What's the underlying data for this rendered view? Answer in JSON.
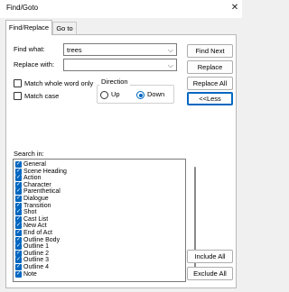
{
  "window": {
    "title": "Find/Goto",
    "close_glyph": "✕"
  },
  "tabs": [
    {
      "label": "Find/Replace",
      "active": true
    },
    {
      "label": "Go to",
      "active": false
    }
  ],
  "find": {
    "label": "Find what:",
    "value": "trees"
  },
  "replace": {
    "label": "Replace with:",
    "value": ""
  },
  "options": {
    "match_whole_word": {
      "label": "Match whole word only",
      "checked": false
    },
    "match_case": {
      "label": "Match case",
      "checked": false
    }
  },
  "direction": {
    "label": "Direction",
    "options": [
      {
        "label": "Up",
        "selected": false
      },
      {
        "label": "Down",
        "selected": true
      }
    ]
  },
  "buttons": {
    "find_next": "Find Next",
    "replace": "Replace",
    "replace_all": "Replace All",
    "less": "<<Less",
    "include_all": "Include All",
    "exclude_all": "Exclude All"
  },
  "search_in": {
    "label": "Search in:",
    "items": [
      {
        "label": "General",
        "checked": true
      },
      {
        "label": "Scene Heading",
        "checked": true
      },
      {
        "label": "Action",
        "checked": true
      },
      {
        "label": "Character",
        "checked": true
      },
      {
        "label": "Parenthetical",
        "checked": true
      },
      {
        "label": "Dialogue",
        "checked": true
      },
      {
        "label": "Transition",
        "checked": true
      },
      {
        "label": "Shot",
        "checked": true
      },
      {
        "label": "Cast List",
        "checked": true
      },
      {
        "label": "New Act",
        "checked": true
      },
      {
        "label": "End of Act",
        "checked": true
      },
      {
        "label": "Outline Body",
        "checked": true
      },
      {
        "label": "Outline 1",
        "checked": true
      },
      {
        "label": "Outline 2",
        "checked": true
      },
      {
        "label": "Outline 3",
        "checked": true
      },
      {
        "label": "Outline 4",
        "checked": true
      },
      {
        "label": "Note",
        "checked": true
      }
    ]
  },
  "colors": {
    "accent": "#0067c0",
    "window_bg": "#f0f0f0",
    "panel_bg": "#ffffff"
  }
}
